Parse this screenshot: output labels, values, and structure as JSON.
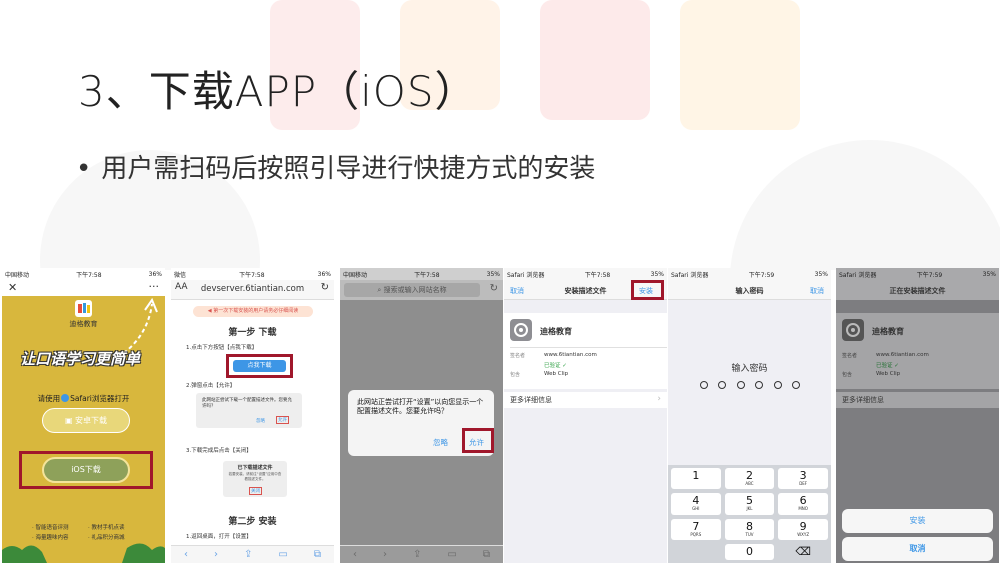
{
  "slide": {
    "title": "3、下载APP（iOS）",
    "bullet": "用户需扫码后按照引导进行快捷方式的安装"
  },
  "phone1": {
    "carrier": "中国移动",
    "time": "下午7:58",
    "battery": "36%",
    "app_name": "迪格教育",
    "slogan": "让口语学习更简单",
    "safari_hint_prefix": "请使用",
    "safari_hint_suffix": "Safari浏览器打开",
    "android_btn": "安卓下载",
    "ios_btn": "iOS下载",
    "features": [
      "· 智能语音评测",
      "· 教材手机点读",
      "· 海量趣味内容",
      "· 礼品积分商城"
    ]
  },
  "phone2": {
    "carrier": "微信",
    "time": "下午7:58",
    "battery": "36%",
    "url": "devserver.6tiantian.com",
    "notice": "第一次下载安装的用户请务必仔细阅读",
    "step1_title": "第一步 下载",
    "step1_a": "1.点击下方按钮【点我下载】",
    "download_btn": "点我下载",
    "step1_b": "2.弹窗点击【允许】",
    "dialog_text": "此网站正尝试下载一个配置描述文件。您要允许吗？",
    "ignore": "忽略",
    "allow": "允许",
    "step1_c": "3.下载完成后点击【关闭】",
    "done_title": "已下载描述文件",
    "done_desc": "若要安装，请前往“设置”应用中查看描述文件。",
    "close": "关闭",
    "step2_title": "第二步 安装",
    "step2_a": "1.返回桌面，打开【设置】"
  },
  "phone3": {
    "carrier": "中国移动",
    "time": "下午7:58",
    "battery": "35%",
    "search_placeholder": "搜索或输入网站名称",
    "alert_text": "此网站正尝试打开“设置”以向您显示一个配置描述文件。您要允许吗？",
    "ignore": "忽略",
    "allow": "允许"
  },
  "phone4": {
    "carrier": "Safari 浏览器",
    "time": "下午7:58",
    "battery": "35%",
    "cancel": "取消",
    "title": "安装描述文件",
    "install": "安装",
    "profile_name": "迪格教育",
    "signer_label": "签名者",
    "signer_value": "www.6tiantian.com",
    "verified": "已验证 ✓",
    "contains_label": "包含",
    "contains_value": "Web Clip",
    "more": "更多详细信息"
  },
  "phone5": {
    "carrier": "Safari 浏览器",
    "time": "下午7:59",
    "battery": "35%",
    "title": "输入密码",
    "cancel": "取消",
    "prompt": "输入密码",
    "keys": [
      {
        "n": "1",
        "l": ""
      },
      {
        "n": "2",
        "l": "ABC"
      },
      {
        "n": "3",
        "l": "DEF"
      },
      {
        "n": "4",
        "l": "GHI"
      },
      {
        "n": "5",
        "l": "JKL"
      },
      {
        "n": "6",
        "l": "MNO"
      },
      {
        "n": "7",
        "l": "PQRS"
      },
      {
        "n": "8",
        "l": "TUV"
      },
      {
        "n": "9",
        "l": "WXYZ"
      },
      {
        "n": "",
        "l": ""
      },
      {
        "n": "0",
        "l": ""
      },
      {
        "n": "⌫",
        "l": ""
      }
    ]
  },
  "phone6": {
    "carrier": "Safari 浏览器",
    "time": "下午7:59",
    "battery": "35%",
    "title": "正在安装描述文件",
    "profile_name": "迪格教育",
    "signer_label": "签名者",
    "signer_value": "www.6tiantian.com",
    "verified": "已验证 ✓",
    "contains_label": "包含",
    "contains_value": "Web Clip",
    "more": "更多详细信息",
    "install": "安装",
    "cancel": "取消"
  }
}
